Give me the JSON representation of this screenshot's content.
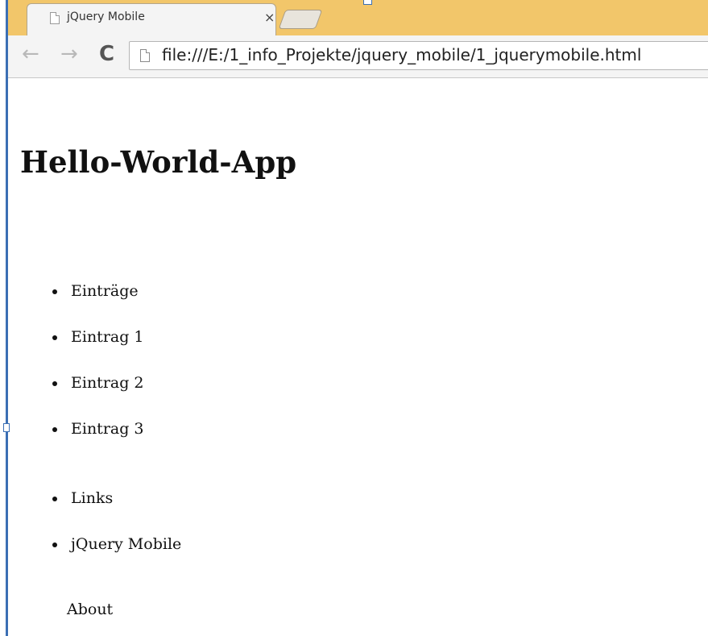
{
  "browser": {
    "tab": {
      "title": "jQuery Mobile",
      "close_glyph": "×"
    },
    "toolbar": {
      "back_glyph": "←",
      "forward_glyph": "→",
      "reload_glyph": "C",
      "url": "file:///E:/1_info_Projekte/jquery_mobile/1_jquerymobile.html"
    }
  },
  "page": {
    "title": "Hello-World-App",
    "lists": [
      {
        "items": [
          "Einträge",
          "Eintrag 1",
          "Eintrag 2",
          "Eintrag 3"
        ]
      },
      {
        "items": [
          "Links",
          "jQuery Mobile"
        ]
      }
    ],
    "about": "About"
  }
}
